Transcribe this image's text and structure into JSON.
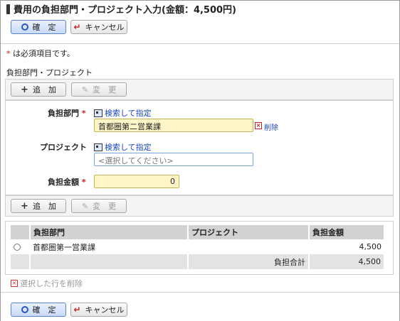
{
  "page": {
    "title": "費用の負担部門・プロジェクト入力(金額：4,500円)"
  },
  "actions": {
    "confirm_label": "確　定",
    "cancel_label": "キャンセル"
  },
  "required_note": {
    "star": "*",
    "text": " は必須項目です。"
  },
  "section": {
    "label": "負担部門・プロジェクト"
  },
  "toolbar": {
    "add_label": "追　加",
    "edit_label": "変　更"
  },
  "form": {
    "department": {
      "label": "負担部門",
      "required": "*",
      "search_link": "検索して指定",
      "value": "首都圏第二営業課",
      "delete_label": "削除"
    },
    "project": {
      "label": "プロジェクト",
      "search_link": "検索して指定",
      "placeholder": "<選択してください>"
    },
    "amount": {
      "label": "負担金額",
      "required": "*",
      "value": "0"
    }
  },
  "table": {
    "columns": [
      "負担部門",
      "プロジェクト",
      "負担金額"
    ],
    "rows": [
      {
        "department": "首都圏第一営業課",
        "project": "",
        "amount": "4,500"
      }
    ],
    "total": {
      "label": "負担合計",
      "value": "4,500"
    }
  },
  "delete_selected_label": "選択した行を削除",
  "icons": {
    "confirm": "radio-ring-icon",
    "cancel": "return-arrow-icon",
    "add": "plus-icon",
    "edit": "pencil-icon",
    "search": "search-list-icon",
    "delete": "x-box-icon"
  },
  "colors": {
    "primary_button": "#c9daf8",
    "required_field": "#fff6c8",
    "link": "#1a46b4",
    "required_star": "#d01818"
  }
}
